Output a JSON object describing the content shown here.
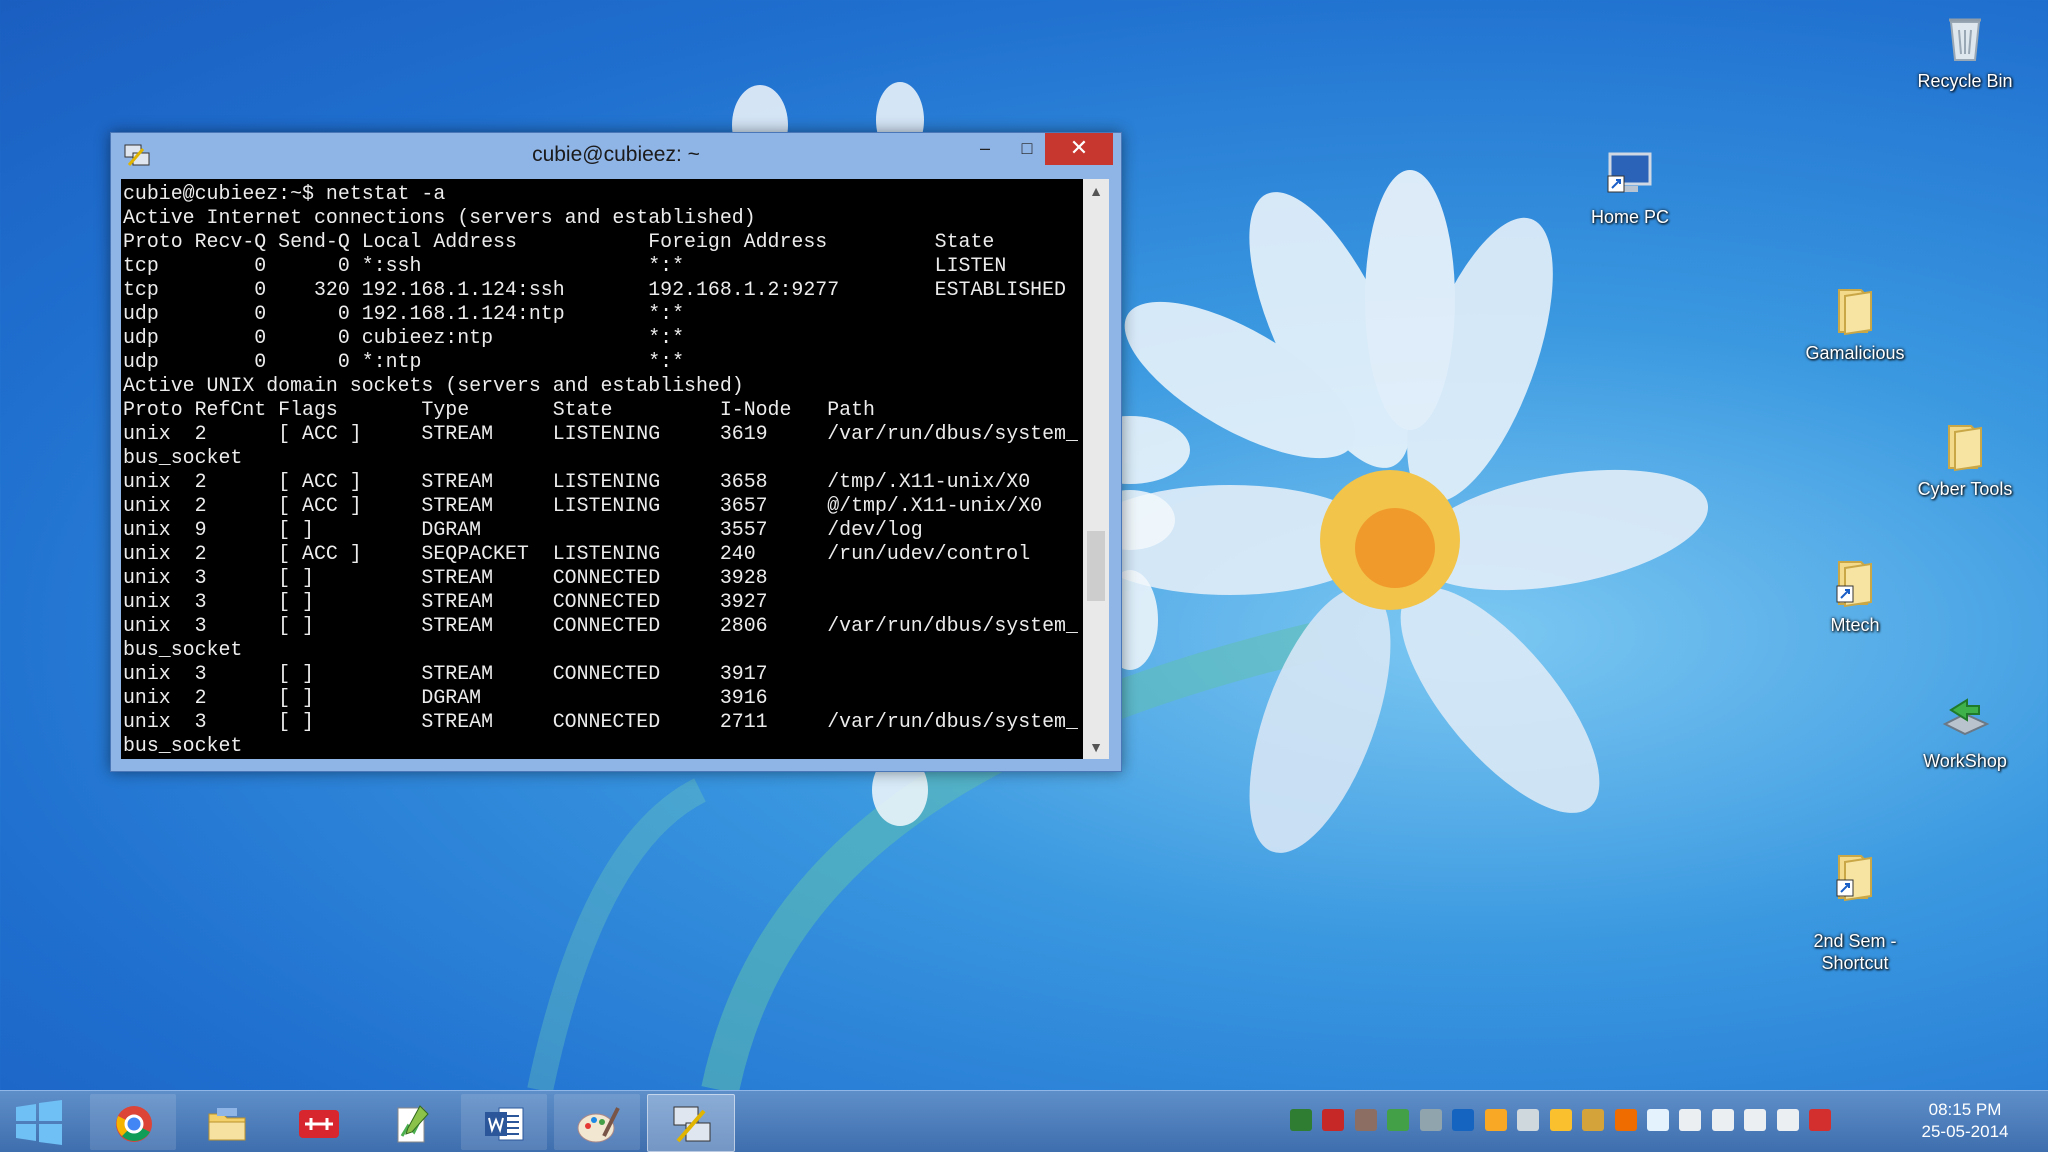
{
  "desktop_icons": [
    {
      "label": "Recycle Bin",
      "icon": "recycle-bin-icon"
    },
    {
      "label": "Home PC",
      "icon": "computer-shortcut-icon"
    },
    {
      "label": "Gamalicious",
      "icon": "folder-icon"
    },
    {
      "label": "Cyber Tools",
      "icon": "folder-icon"
    },
    {
      "label": "Mtech",
      "icon": "folder-shortcut-icon"
    },
    {
      "label": "WorkShop",
      "icon": "network-shortcut-icon"
    },
    {
      "label": "2nd Sem -\nShortcut",
      "icon": "folder-shortcut-icon"
    }
  ],
  "window": {
    "title": "cubie@cubieez: ~",
    "minimize": "–",
    "maximize": "□",
    "close": "✕"
  },
  "terminal": {
    "lines": [
      "cubie@cubieez:~$ netstat -a",
      "Active Internet connections (servers and established)",
      "Proto Recv-Q Send-Q Local Address           Foreign Address         State",
      "tcp        0      0 *:ssh                   *:*                     LISTEN",
      "tcp        0    320 192.168.1.124:ssh       192.168.1.2:9277        ESTABLISHED",
      "udp        0      0 192.168.1.124:ntp       *:*",
      "udp        0      0 cubieez:ntp             *:*",
      "udp        0      0 *:ntp                   *:*",
      "Active UNIX domain sockets (servers and established)",
      "Proto RefCnt Flags       Type       State         I-Node   Path",
      "unix  2      [ ACC ]     STREAM     LISTENING     3619     /var/run/dbus/system_",
      "bus_socket",
      "unix  2      [ ACC ]     STREAM     LISTENING     3658     /tmp/.X11-unix/X0",
      "unix  2      [ ACC ]     STREAM     LISTENING     3657     @/tmp/.X11-unix/X0",
      "unix  9      [ ]         DGRAM                    3557     /dev/log",
      "unix  2      [ ACC ]     SEQPACKET  LISTENING     240      /run/udev/control",
      "unix  3      [ ]         STREAM     CONNECTED     3928",
      "unix  3      [ ]         STREAM     CONNECTED     3927",
      "unix  3      [ ]         STREAM     CONNECTED     2806     /var/run/dbus/system_",
      "bus_socket",
      "unix  3      [ ]         STREAM     CONNECTED     3917",
      "unix  2      [ ]         DGRAM                    3916",
      "unix  3      [ ]         STREAM     CONNECTED     2711     /var/run/dbus/system_",
      "bus_socket"
    ]
  },
  "scrollbar": {
    "up": "▲",
    "down": "▼"
  },
  "taskbar": {
    "items": [
      {
        "name": "chrome-icon",
        "state": "pinned"
      },
      {
        "name": "file-explorer-icon",
        "state": "normal"
      },
      {
        "name": "network-tool-icon",
        "state": "normal"
      },
      {
        "name": "notepad-plus-icon",
        "state": "normal"
      },
      {
        "name": "word-icon",
        "state": "pinned"
      },
      {
        "name": "paint-icon",
        "state": "pinned"
      },
      {
        "name": "putty-icon",
        "state": "active"
      }
    ],
    "clock_time": "08:15 PM",
    "clock_date": "25-05-2014"
  },
  "colors": {
    "terminal_bg": "#000000",
    "terminal_fg": "#ececec",
    "close_red": "#c7372f"
  }
}
